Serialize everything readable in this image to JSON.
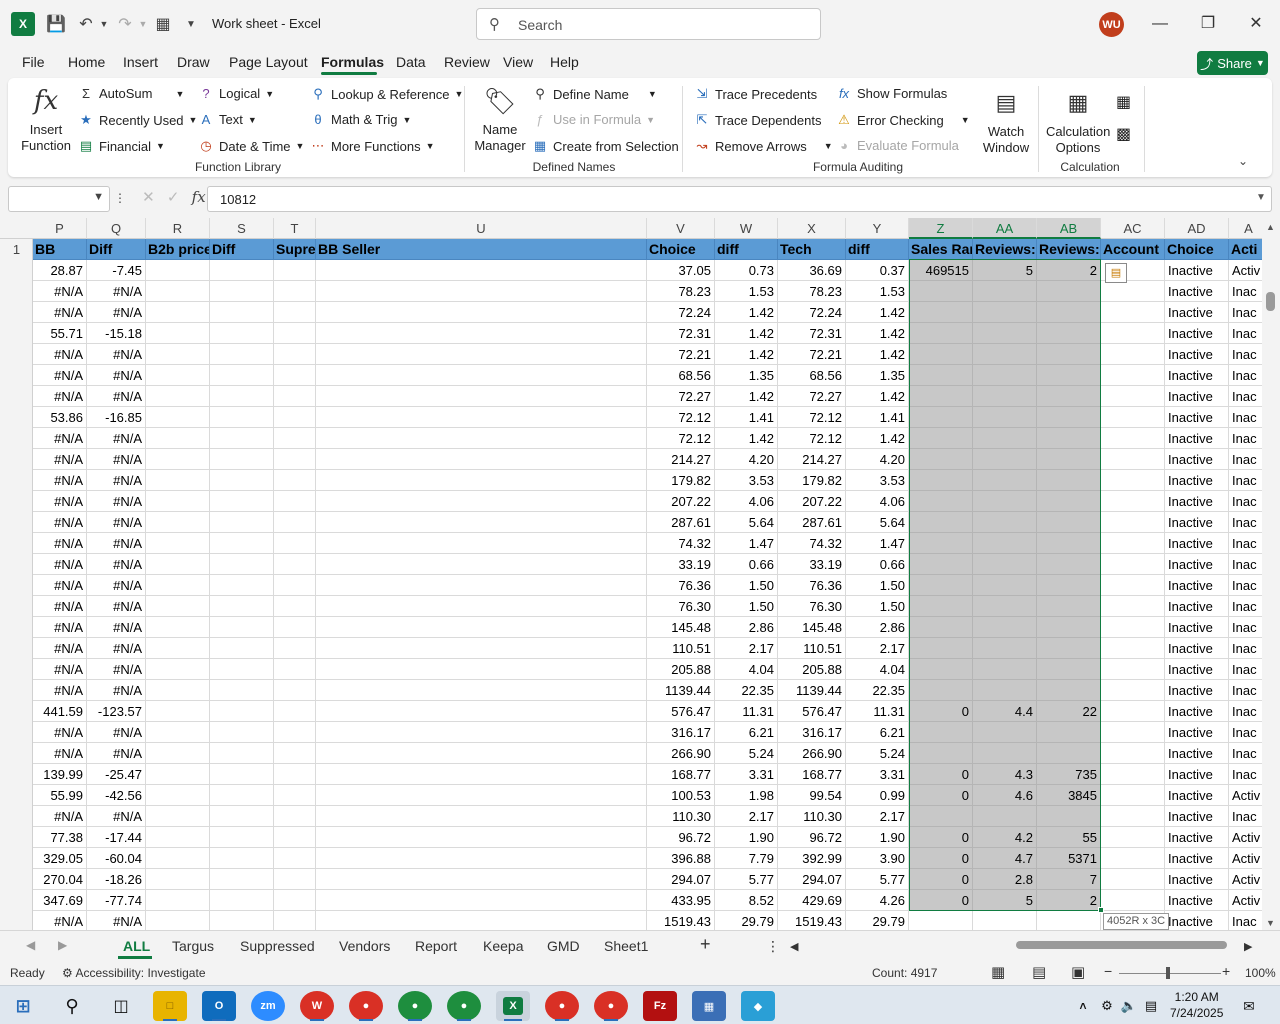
{
  "window": {
    "title": "Work sheet  -  Excel",
    "search_placeholder": "Search",
    "avatar_initials": "WU",
    "accent": "#107c41"
  },
  "menu": {
    "tabs": [
      "File",
      "Home",
      "Insert",
      "Draw",
      "Page Layout",
      "Formulas",
      "Data",
      "Review",
      "View",
      "Help"
    ],
    "active": "Formulas",
    "share_label": "Share"
  },
  "ribbon": {
    "insert_function": "Insert\nFunction",
    "autosum": "AutoSum",
    "recently_used": "Recently Used",
    "financial": "Financial",
    "logical": "Logical",
    "text": "Text",
    "date_time": "Date & Time",
    "lookup": "Lookup & Reference",
    "math": "Math & Trig",
    "more": "More Functions",
    "function_library": "Function Library",
    "name_manager": "Name\nManager",
    "define_name": "Define Name",
    "use_in_formula": "Use in Formula",
    "create_from_selection": "Create from Selection",
    "defined_names": "Defined Names",
    "trace_precedents": "Trace Precedents",
    "trace_dependents": "Trace Dependents",
    "remove_arrows": "Remove Arrows",
    "show_formulas": "Show Formulas",
    "error_checking": "Error Checking",
    "evaluate_formula": "Evaluate Formula",
    "watch_window": "Watch\nWindow",
    "formula_auditing": "Formula Auditing",
    "calc_options": "Calculation\nOptions",
    "calculation": "Calculation"
  },
  "formula_bar": {
    "name_box": "",
    "value": "10812"
  },
  "grid": {
    "columns": [
      "P",
      "Q",
      "R",
      "S",
      "T",
      "U",
      "V",
      "W",
      "X",
      "Y",
      "Z",
      "AA",
      "AB",
      "AC",
      "AD",
      "A"
    ],
    "selected_columns": [
      "Z",
      "AA",
      "AB"
    ],
    "headers": [
      "BB",
      "Diff",
      "B2b price",
      "Diff",
      "Supre",
      "BB Seller",
      "Choice",
      "diff",
      "Tech",
      "diff",
      "Sales Rar",
      "Reviews:",
      "Reviews:",
      "Account",
      "Choice",
      "Acti"
    ],
    "row_number": "1",
    "rows": [
      [
        "28.87",
        "-7.45",
        "37.05",
        "0.73",
        "36.69",
        "0.37",
        "469515",
        "5",
        "2",
        "Inactive",
        "Activ"
      ],
      [
        "#N/A",
        "#N/A",
        "78.23",
        "1.53",
        "78.23",
        "1.53",
        "",
        "",
        "",
        "Inactive",
        "Inac"
      ],
      [
        "#N/A",
        "#N/A",
        "72.24",
        "1.42",
        "72.24",
        "1.42",
        "",
        "",
        "",
        "Inactive",
        "Inac"
      ],
      [
        "55.71",
        "-15.18",
        "72.31",
        "1.42",
        "72.31",
        "1.42",
        "",
        "",
        "",
        "Inactive",
        "Inac"
      ],
      [
        "#N/A",
        "#N/A",
        "72.21",
        "1.42",
        "72.21",
        "1.42",
        "",
        "",
        "",
        "Inactive",
        "Inac"
      ],
      [
        "#N/A",
        "#N/A",
        "68.56",
        "1.35",
        "68.56",
        "1.35",
        "",
        "",
        "",
        "Inactive",
        "Inac"
      ],
      [
        "#N/A",
        "#N/A",
        "72.27",
        "1.42",
        "72.27",
        "1.42",
        "",
        "",
        "",
        "Inactive",
        "Inac"
      ],
      [
        "53.86",
        "-16.85",
        "72.12",
        "1.41",
        "72.12",
        "1.41",
        "",
        "",
        "",
        "Inactive",
        "Inac"
      ],
      [
        "#N/A",
        "#N/A",
        "72.12",
        "1.42",
        "72.12",
        "1.42",
        "",
        "",
        "",
        "Inactive",
        "Inac"
      ],
      [
        "#N/A",
        "#N/A",
        "214.27",
        "4.20",
        "214.27",
        "4.20",
        "",
        "",
        "",
        "Inactive",
        "Inac"
      ],
      [
        "#N/A",
        "#N/A",
        "179.82",
        "3.53",
        "179.82",
        "3.53",
        "",
        "",
        "",
        "Inactive",
        "Inac"
      ],
      [
        "#N/A",
        "#N/A",
        "207.22",
        "4.06",
        "207.22",
        "4.06",
        "",
        "",
        "",
        "Inactive",
        "Inac"
      ],
      [
        "#N/A",
        "#N/A",
        "287.61",
        "5.64",
        "287.61",
        "5.64",
        "",
        "",
        "",
        "Inactive",
        "Inac"
      ],
      [
        "#N/A",
        "#N/A",
        "74.32",
        "1.47",
        "74.32",
        "1.47",
        "",
        "",
        "",
        "Inactive",
        "Inac"
      ],
      [
        "#N/A",
        "#N/A",
        "33.19",
        "0.66",
        "33.19",
        "0.66",
        "",
        "",
        "",
        "Inactive",
        "Inac"
      ],
      [
        "#N/A",
        "#N/A",
        "76.36",
        "1.50",
        "76.36",
        "1.50",
        "",
        "",
        "",
        "Inactive",
        "Inac"
      ],
      [
        "#N/A",
        "#N/A",
        "76.30",
        "1.50",
        "76.30",
        "1.50",
        "",
        "",
        "",
        "Inactive",
        "Inac"
      ],
      [
        "#N/A",
        "#N/A",
        "145.48",
        "2.86",
        "145.48",
        "2.86",
        "",
        "",
        "",
        "Inactive",
        "Inac"
      ],
      [
        "#N/A",
        "#N/A",
        "110.51",
        "2.17",
        "110.51",
        "2.17",
        "",
        "",
        "",
        "Inactive",
        "Inac"
      ],
      [
        "#N/A",
        "#N/A",
        "205.88",
        "4.04",
        "205.88",
        "4.04",
        "",
        "",
        "",
        "Inactive",
        "Inac"
      ],
      [
        "#N/A",
        "#N/A",
        "1139.44",
        "22.35",
        "1139.44",
        "22.35",
        "",
        "",
        "",
        "Inactive",
        "Inac"
      ],
      [
        "441.59",
        "-123.57",
        "576.47",
        "11.31",
        "576.47",
        "11.31",
        "0",
        "4.4",
        "22",
        "Inactive",
        "Inac"
      ],
      [
        "#N/A",
        "#N/A",
        "316.17",
        "6.21",
        "316.17",
        "6.21",
        "",
        "",
        "",
        "Inactive",
        "Inac"
      ],
      [
        "#N/A",
        "#N/A",
        "266.90",
        "5.24",
        "266.90",
        "5.24",
        "",
        "",
        "",
        "Inactive",
        "Inac"
      ],
      [
        "139.99",
        "-25.47",
        "168.77",
        "3.31",
        "168.77",
        "3.31",
        "0",
        "4.3",
        "735",
        "Inactive",
        "Inac"
      ],
      [
        "55.99",
        "-42.56",
        "100.53",
        "1.98",
        "99.54",
        "0.99",
        "0",
        "4.6",
        "3845",
        "Inactive",
        "Activ"
      ],
      [
        "#N/A",
        "#N/A",
        "110.30",
        "2.17",
        "110.30",
        "2.17",
        "",
        "",
        "",
        "Inactive",
        "Inac"
      ],
      [
        "77.38",
        "-17.44",
        "96.72",
        "1.90",
        "96.72",
        "1.90",
        "0",
        "4.2",
        "55",
        "Inactive",
        "Activ"
      ],
      [
        "329.05",
        "-60.04",
        "396.88",
        "7.79",
        "392.99",
        "3.90",
        "0",
        "4.7",
        "5371",
        "Inactive",
        "Activ"
      ],
      [
        "270.04",
        "-18.26",
        "294.07",
        "5.77",
        "294.07",
        "5.77",
        "0",
        "2.8",
        "7",
        "Inactive",
        "Activ"
      ],
      [
        "347.69",
        "-77.74",
        "433.95",
        "8.52",
        "429.69",
        "4.26",
        "0",
        "5",
        "2",
        "Inactive",
        "Activ"
      ],
      [
        "#N/A",
        "#N/A",
        "1519.43",
        "29.79",
        "1519.43",
        "29.79",
        "",
        "",
        "",
        "Inactive",
        "Inac"
      ]
    ],
    "selection_size": "4052R x 3C"
  },
  "sheets": {
    "tabs": [
      "ALL",
      "Targus",
      "Suppressed",
      "Vendors",
      "Report",
      "Keepa",
      "GMD",
      "Sheet1"
    ],
    "active": "ALL"
  },
  "status": {
    "ready": "Ready",
    "accessibility": "Accessibility: Investigate",
    "count": "Count: 4917",
    "zoom": "100%"
  },
  "taskbar": {
    "time": "1:20 AM",
    "date": "7/24/2025"
  }
}
